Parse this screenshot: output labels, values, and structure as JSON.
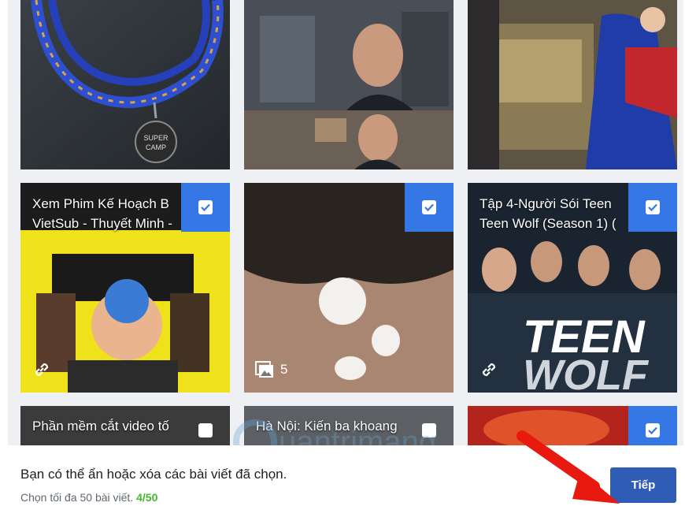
{
  "tiles_row2": [
    {
      "caption_line1": "Xem Phim Kế Hoạch B",
      "caption_line2": "VietSub - Thuyết Minh -",
      "checked": true,
      "type": "link"
    },
    {
      "caption_line1": "",
      "caption_line2": "",
      "checked": true,
      "type": "photos",
      "photo_count": "5"
    },
    {
      "caption_line1": "Tập 4-Người Sói Teen",
      "caption_line2": "Teen Wolf (Season 1) (",
      "checked": true,
      "type": "link"
    }
  ],
  "tiles_row3": [
    {
      "caption_line1": "Phần mềm cắt video tố",
      "checked": false
    },
    {
      "caption_line1": "Hà Nội: Kiến ba khoang",
      "checked": false
    },
    {
      "caption_line1": "",
      "checked": true
    }
  ],
  "poster_text": {
    "teen": "TEEN",
    "wolf": "WOLF",
    "super_camp": "SUPER CAMP"
  },
  "footer": {
    "main_text": "Bạn có thể ẩn hoặc xóa các bài viết đã chọn.",
    "sub_text": "Chọn tối đa 50 bài viết.",
    "count": "4/50",
    "next_label": "Tiếp"
  },
  "watermark": "uantrimang",
  "colors": {
    "selected": "#3578e5",
    "next_button": "#2f5cb5",
    "count": "#42b72a"
  }
}
